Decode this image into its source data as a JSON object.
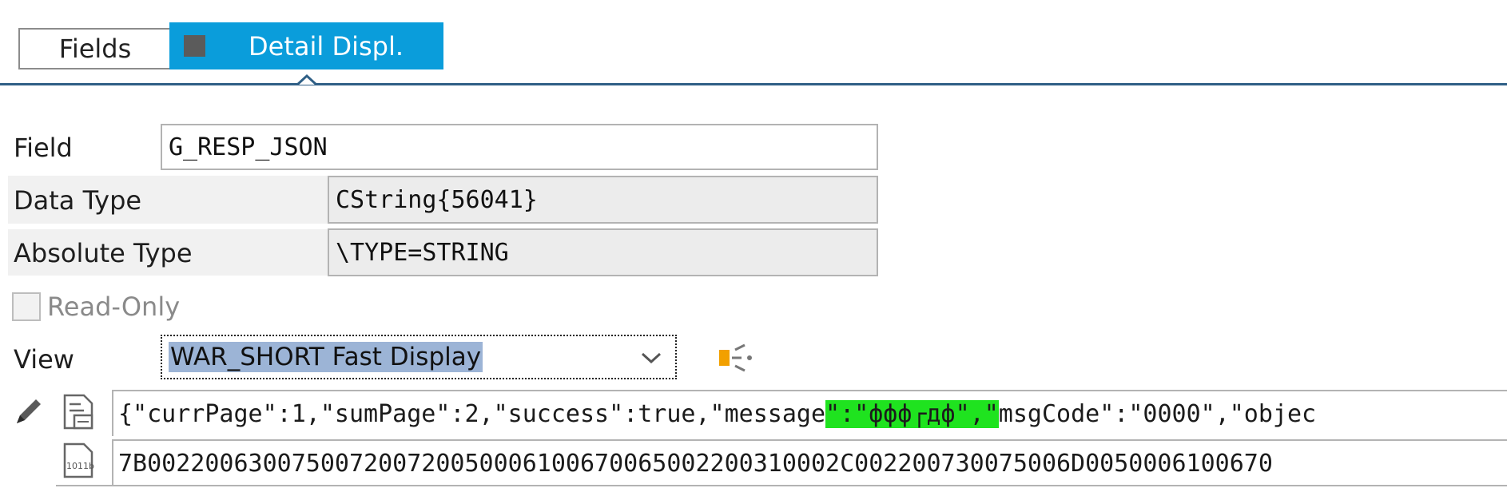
{
  "tabs": {
    "fields": "Fields",
    "detail": "Detail Displ."
  },
  "rows": {
    "field": {
      "label": "Field",
      "value": "G_RESP_JSON"
    },
    "data_type": {
      "label": "Data Type",
      "value": "CString{56041}"
    },
    "absolute_type": {
      "label": "Absolute Type",
      "value": "\\TYPE=STRING"
    }
  },
  "read_only": {
    "label": "Read-Only",
    "checked": false
  },
  "view": {
    "label": "View",
    "selected": "WAR_SHORT Fast Display"
  },
  "content": {
    "text_part1": "{\"currPage\":1,\"sumPage\":2,\"success\":true,\"message",
    "text_hl": "\":\"ффф┌дф\",\"",
    "text_part2": "msgCode\":\"0000\",\"objec",
    "hex": "7B002200630075007200720050006100670065002200310002C002200730075006D0050006100670"
  },
  "colors": {
    "tab_active": "#0a9ddb",
    "highlight": "#1fe31f",
    "selection": "#9cb4d6",
    "tab_line": "#2f5f86"
  }
}
